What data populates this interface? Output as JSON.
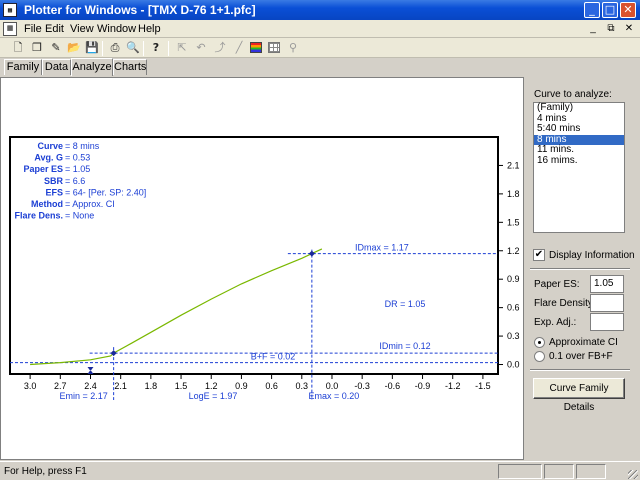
{
  "window": {
    "title": "Plotter for Windows - [TMX D-76 1+1.pfc]",
    "app_icon": "grid-document-icon"
  },
  "menu": [
    "File",
    "Edit",
    "View",
    "Window",
    "Help"
  ],
  "toolbar_icons": [
    "new-document-icon",
    "copy-document-icon",
    "edit-document-icon",
    "open-folder-icon",
    "save-disk-icon",
    "print-icon",
    "print-preview-icon",
    "help-icon",
    "pointer-tool-icon",
    "undo-tool-icon",
    "curve-tool-icon",
    "line-tool-icon",
    "palette-icon",
    "grid-icon",
    "zoom-icon"
  ],
  "tabs": [
    "Family",
    "Data",
    "Analyze",
    "Charts"
  ],
  "active_tab": "Analyze",
  "info": [
    {
      "label": "Curve",
      "value": "8 mins"
    },
    {
      "label": "Avg. G",
      "value": "0.53"
    },
    {
      "label": "Paper ES",
      "value": "1.05"
    },
    {
      "label": "SBR",
      "value": "6.6"
    },
    {
      "label": "EFS",
      "value": "64- [Per. SP: 2.40]"
    },
    {
      "label": "Method",
      "value": "Approx. CI"
    },
    {
      "label": "Flare Dens.",
      "value": "None"
    }
  ],
  "annotations": {
    "idmax": "IDmax = 1.17",
    "dr": "DR = 1.05",
    "idmin": "IDmin = 0.12",
    "bf": "B+F = 0.02",
    "emin": "Emin = 2.17",
    "loge": "LogE = 1.97",
    "emax": "Emax = 0.20"
  },
  "chart_data": {
    "type": "line",
    "x_tick_labels": [
      "3.0",
      "2.7",
      "2.4",
      "2.1",
      "1.8",
      "1.5",
      "1.2",
      "0.9",
      "0.6",
      "0.3",
      "0.0",
      "-0.3",
      "-0.6",
      "-0.9",
      "-1.2",
      "-1.5"
    ],
    "y_tick_labels": [
      "0.0",
      "0.3",
      "0.6",
      "0.9",
      "1.2",
      "1.5",
      "1.8",
      "2.1"
    ],
    "xlim": [
      3.2,
      -1.65
    ],
    "ylim": [
      -0.1,
      2.4
    ],
    "series": [
      {
        "color": "#7ab800",
        "x": [
          3.0,
          2.7,
          2.4,
          2.2,
          2.17,
          2.0,
          1.8,
          1.5,
          1.2,
          0.9,
          0.6,
          0.3,
          0.2,
          0.1
        ],
        "y": [
          0.0,
          0.02,
          0.05,
          0.09,
          0.12,
          0.22,
          0.34,
          0.52,
          0.69,
          0.85,
          0.99,
          1.12,
          1.17,
          1.22
        ]
      }
    ],
    "markers": [
      {
        "x": 2.17,
        "y": 0.12
      },
      {
        "x": 0.2,
        "y": 1.17
      }
    ],
    "guide_lines": {
      "h": [
        1.17,
        0.12,
        0.02
      ],
      "v": [
        2.17,
        0.2
      ]
    },
    "arrow_marker_x": 2.4,
    "text_color": "#1c3fd4",
    "guide_color": "#1c3fd4"
  },
  "side": {
    "curve_label": "Curve to analyze:",
    "curves": [
      "(Family)",
      "4  mins",
      "5:40 mins",
      "8 mins",
      "11 mins.",
      "16 mims."
    ],
    "selected_curve": "8 mins",
    "display_info_label": "Display Information",
    "display_info_checked": true,
    "paper_es_label": "Paper ES:",
    "paper_es_value": "1.05",
    "flare_label": "Flare Density:",
    "flare_value": "",
    "exp_label": "Exp. Adj.:",
    "exp_value": "",
    "radio_ci": "Approximate CI",
    "radio_fb": "0.1 over FB+F",
    "family_button": "Curve Family Details"
  },
  "status": "For Help, press F1"
}
